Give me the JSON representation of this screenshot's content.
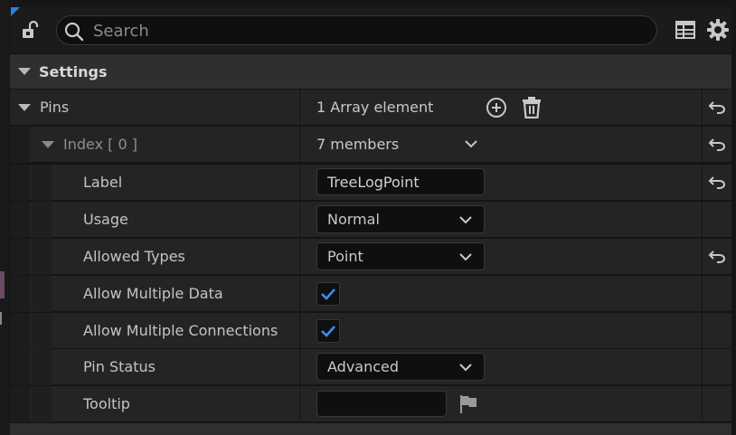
{
  "toolbar": {
    "search_placeholder": "Search",
    "icons": [
      "lock-icon",
      "search-icon",
      "table-view-icon",
      "gear-icon"
    ]
  },
  "section": {
    "title": "Settings"
  },
  "pins": {
    "label": "Pins",
    "value": "1 Array element",
    "icons": [
      "add-element-icon",
      "delete-icon",
      "reset-icon"
    ]
  },
  "index_row": {
    "label": "Index [ 0 ]",
    "value": "7 members"
  },
  "fields": {
    "label": {
      "label": "Label",
      "value": "TreeLogPoint"
    },
    "usage": {
      "label": "Usage",
      "value": "Normal"
    },
    "allowed_types": {
      "label": "Allowed Types",
      "value": "Point"
    },
    "allow_multiple_data": {
      "label": "Allow Multiple Data",
      "checked": true
    },
    "allow_multiple_connections": {
      "label": "Allow Multiple Connections",
      "checked": true
    },
    "pin_status": {
      "label": "Pin Status",
      "value": "Advanced"
    },
    "tooltip": {
      "label": "Tooltip",
      "value": ""
    }
  },
  "colors": {
    "accent_blue": "#2f7de0",
    "check_blue": "#3a8ef0",
    "panel_bg": "#242424",
    "header_bg": "#2f2f2f"
  }
}
